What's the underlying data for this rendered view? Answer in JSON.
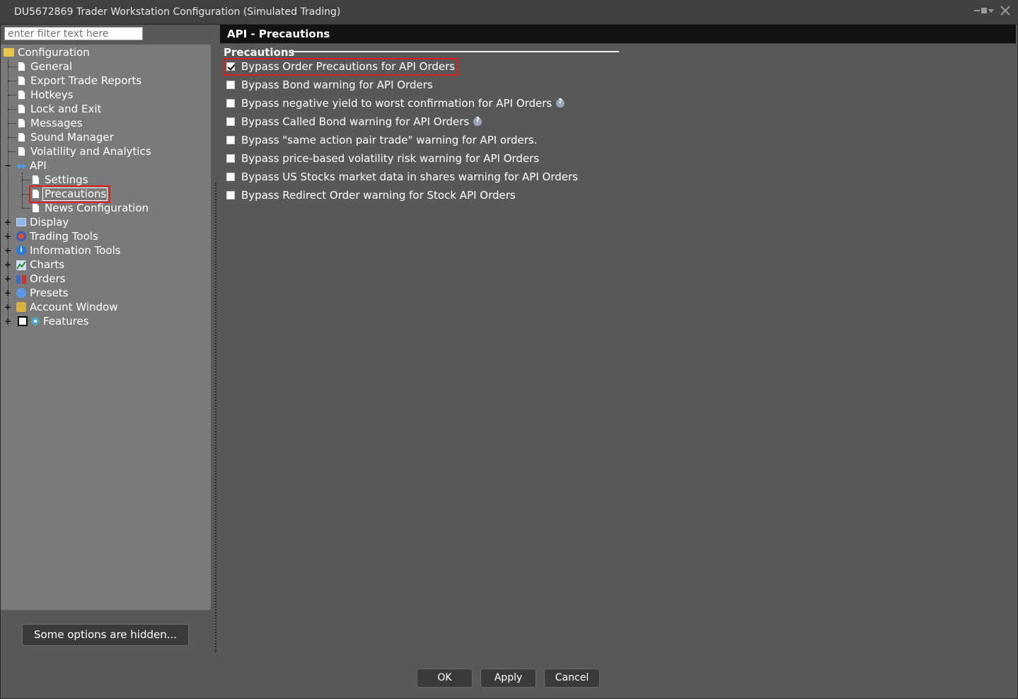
{
  "window": {
    "title": "DU5672869 Trader Workstation Configuration (Simulated Trading)"
  },
  "filter": {
    "placeholder": "enter filter text here"
  },
  "tree": {
    "root": "Configuration",
    "general": "General",
    "export": "Export Trade Reports",
    "hotkeys": "Hotkeys",
    "lock": "Lock and Exit",
    "messages": "Messages",
    "sound": "Sound Manager",
    "volatility": "Volatility and Analytics",
    "api": "API",
    "settings": "Settings",
    "precautions": "Precautions",
    "news": "News Configuration",
    "display": "Display",
    "trading_tools": "Trading Tools",
    "info_tools": "Information Tools",
    "charts": "Charts",
    "orders": "Orders",
    "presets": "Presets",
    "account": "Account Window",
    "features": "Features"
  },
  "hidden_button": "Some options are hidden...",
  "panel": {
    "header": "API - Precautions",
    "section": "Precautions",
    "options": [
      {
        "label": "Bypass Order Precautions for API Orders",
        "checked": true
      },
      {
        "label": "Bypass Bond warning for API Orders",
        "checked": false
      },
      {
        "label": "Bypass negative yield to worst confirmation for API Orders",
        "checked": false
      },
      {
        "label": "Bypass Called Bond warning for API Orders",
        "checked": false
      },
      {
        "label": "Bypass \"same action pair trade\" warning for API orders.",
        "checked": false
      },
      {
        "label": "Bypass price-based volatility risk warning for API Orders",
        "checked": false
      },
      {
        "label": "Bypass US Stocks market data in shares warning for API Orders",
        "checked": false
      },
      {
        "label": "Bypass Redirect Order warning for Stock API Orders",
        "checked": false
      }
    ]
  },
  "buttons": {
    "ok": "OK",
    "apply": "Apply",
    "cancel": "Cancel"
  },
  "colors": {
    "highlight": "#e02020",
    "panel_bg": "#585858",
    "tree_bg": "#7a7a7a"
  }
}
